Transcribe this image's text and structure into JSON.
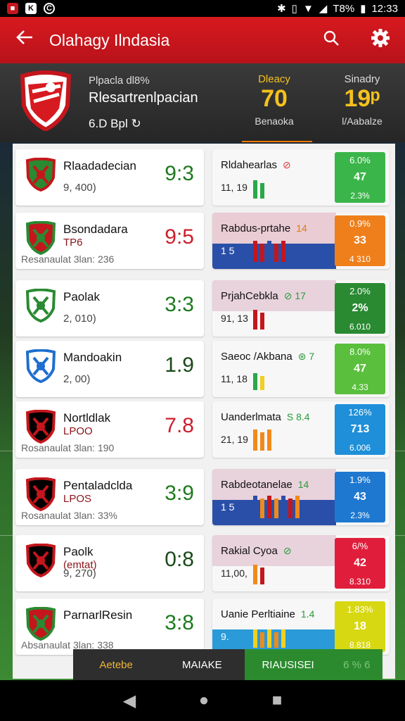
{
  "status": {
    "time": "12:33",
    "battery": "T8%"
  },
  "appbar": {
    "title": "Olahagy Ilndasia",
    "back_icon": "arrow-left-icon",
    "search_icon": "search-icon",
    "settings_icon": "gear-icon"
  },
  "header": {
    "sub": "Plpacla dl8%",
    "name": "Rlesartrenlpacian",
    "meta": "6.D Bpl ↻",
    "stat1": {
      "label": "Dleacy",
      "value": "70",
      "bottom": "Benaoka"
    },
    "stat2": {
      "label": "Sinadry",
      "value": "19ᵖ",
      "bottom": "l/Aabalze"
    }
  },
  "rows": [
    {
      "name": "Rlaadadecian",
      "sub": "",
      "num": "9, 400)",
      "info": "",
      "score": "9:3",
      "score_color": "green",
      "rtitle": "Rldahearlas",
      "rmark": "⊘",
      "rmark_color": "#d33",
      "rnum": "11, 19",
      "pct": [
        "6.0%",
        "47",
        "2.3%"
      ],
      "pct_color": "#3ab54a"
    },
    {
      "name": "Bsondadara",
      "sub": "TP6",
      "num": "",
      "info": "Resanaulat 3lan: 236",
      "score": "9:5",
      "score_color": "red",
      "rtitle": "Rabdus-prtahe",
      "rmark": "14",
      "rmark_color": "#e27a10",
      "rnum": "1 5",
      "pct": [
        "0.9%",
        "33",
        "4 310"
      ],
      "pct_color": "#ef7f1a"
    },
    {
      "name": "Paolak",
      "sub": "",
      "num": "2, 010)",
      "info": "",
      "score": "3:3",
      "score_color": "green",
      "rtitle": "PrjahCebkla",
      "rmark": "⊘  17",
      "rmark_color": "#2a9a3a",
      "rnum": "91, 13",
      "pct": [
        "2.0%",
        "2%",
        "6.010"
      ],
      "pct_color": "#2a8a32"
    },
    {
      "name": "Mandoakin",
      "sub": "",
      "num": "2, 00)",
      "info": "",
      "score": "1.9",
      "score_color": "dark",
      "rtitle": "Saeoc /Akbana",
      "rmark": "⊛ 7",
      "rmark_color": "#2a9a3a",
      "rnum": "11, 18",
      "pct": [
        "8.0%",
        "47",
        "4.33"
      ],
      "pct_color": "#59bf3c"
    },
    {
      "name": "Nortldlak",
      "sub": "LPOO",
      "num": "",
      "info": "Rosanaulat 3lan: 190",
      "score": "7.8",
      "score_color": "red",
      "rtitle": "Uanderlmata",
      "rmark": "S 8.4",
      "rmark_color": "#2a9a3a",
      "rnum": "21, 19",
      "pct": [
        "126%",
        "713",
        "6.006"
      ],
      "pct_color": "#1e8fd8"
    },
    {
      "name": "Pentaladclda",
      "sub": "LPOS",
      "num": "",
      "info": "Rosanaulat 3lan: 33%",
      "score": "3:9",
      "score_color": "green",
      "rtitle": "Rabdeotanelae",
      "rmark": "14",
      "rmark_color": "#2a9a3a",
      "rnum": "1 5",
      "pct": [
        "1.9%",
        "43",
        "2.3%"
      ],
      "pct_color": "#1e78d0"
    },
    {
      "name": "Paolk",
      "sub": "(emtat)",
      "num": "9, 270)",
      "info": "",
      "score": "0:8",
      "score_color": "dark",
      "rtitle": "Rakial Cyoa",
      "rmark": "⊘",
      "rmark_color": "#2a9a3a",
      "rnum": "11,00,",
      "pct": [
        "6/%",
        "42",
        "8.310"
      ],
      "pct_color": "#e01e3c"
    },
    {
      "name": "ParnarlResin",
      "sub": "",
      "num": "",
      "info": "Absanaulat 3lan: 338",
      "score": "3:8",
      "score_color": "green",
      "rtitle": "Uanie Perltiaine",
      "rmark": "1.4",
      "rmark_color": "#2a9a3a",
      "rnum": "9.",
      "pct": [
        "1.83%",
        "18",
        "8.818"
      ],
      "pct_color": "#d7d812"
    }
  ],
  "tabbar": {
    "t1": "Aetebe",
    "t2": "MAIAKE",
    "t3": "RIAUSISEI",
    "t4": "6 % 6"
  },
  "nav": {
    "back": "◀",
    "home": "●",
    "recent": "■"
  }
}
